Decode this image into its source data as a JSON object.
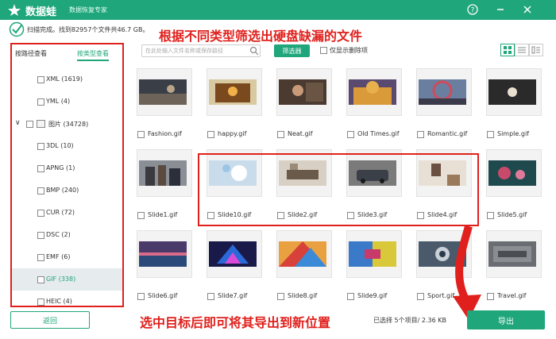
{
  "titlebar": {
    "app_name": "数据蛙",
    "app_subtitle": "数据恢复专家",
    "help_icon": "question-circle-icon",
    "minimize_icon": "minus-icon",
    "close_icon": "close-icon"
  },
  "status": {
    "text": "扫描完成。找到82957个文件共46.7 GB。"
  },
  "annotations": {
    "top": "根据不同类型筛选出硬盘缺漏的文件",
    "bottom": "选中目标后即可将其导出到新位置"
  },
  "left_panel": {
    "tab_path": "按路径查看",
    "tab_type": "按类型查看",
    "types": [
      {
        "label": "XML (1619)"
      },
      {
        "label": "YML (4)"
      },
      {
        "label": "图片 (34728)"
      },
      {
        "label": "3DL (10)"
      },
      {
        "label": "APNG (1)"
      },
      {
        "label": "BMP (240)"
      },
      {
        "label": "CUR (72)"
      },
      {
        "label": "DSC (2)"
      },
      {
        "label": "EMF (6)"
      },
      {
        "label": "GIF (338)"
      },
      {
        "label": "HEIC (4)"
      }
    ],
    "back_label": "返回"
  },
  "toolbar": {
    "search_placeholder": "在此处输入文件名称或保存路径",
    "filter_label": "筛选器",
    "deleted_only_label": "仅显示删除项"
  },
  "files": [
    {
      "name": "Fashion.gif"
    },
    {
      "name": "happy.gif"
    },
    {
      "name": "Neat.gif"
    },
    {
      "name": "Old Times.gif"
    },
    {
      "name": "Romantic.gif"
    },
    {
      "name": "Simple.gif"
    },
    {
      "name": "Slide1.gif"
    },
    {
      "name": "Slide10.gif"
    },
    {
      "name": "Slide2.gif"
    },
    {
      "name": "Slide3.gif"
    },
    {
      "name": "Slide4.gif"
    },
    {
      "name": "Slide5.gif"
    },
    {
      "name": "Slide6.gif"
    },
    {
      "name": "Slide7.gif"
    },
    {
      "name": "Slide8.gif"
    },
    {
      "name": "Slide9.gif"
    },
    {
      "name": "Sport.gif"
    },
    {
      "name": "Travel.gif"
    }
  ],
  "footer": {
    "selection_info": "已选择 5个项目/ 2.36 KB",
    "export_label": "导出"
  },
  "colors": {
    "accent": "#1fa67a",
    "annotation": "#e0201c"
  }
}
